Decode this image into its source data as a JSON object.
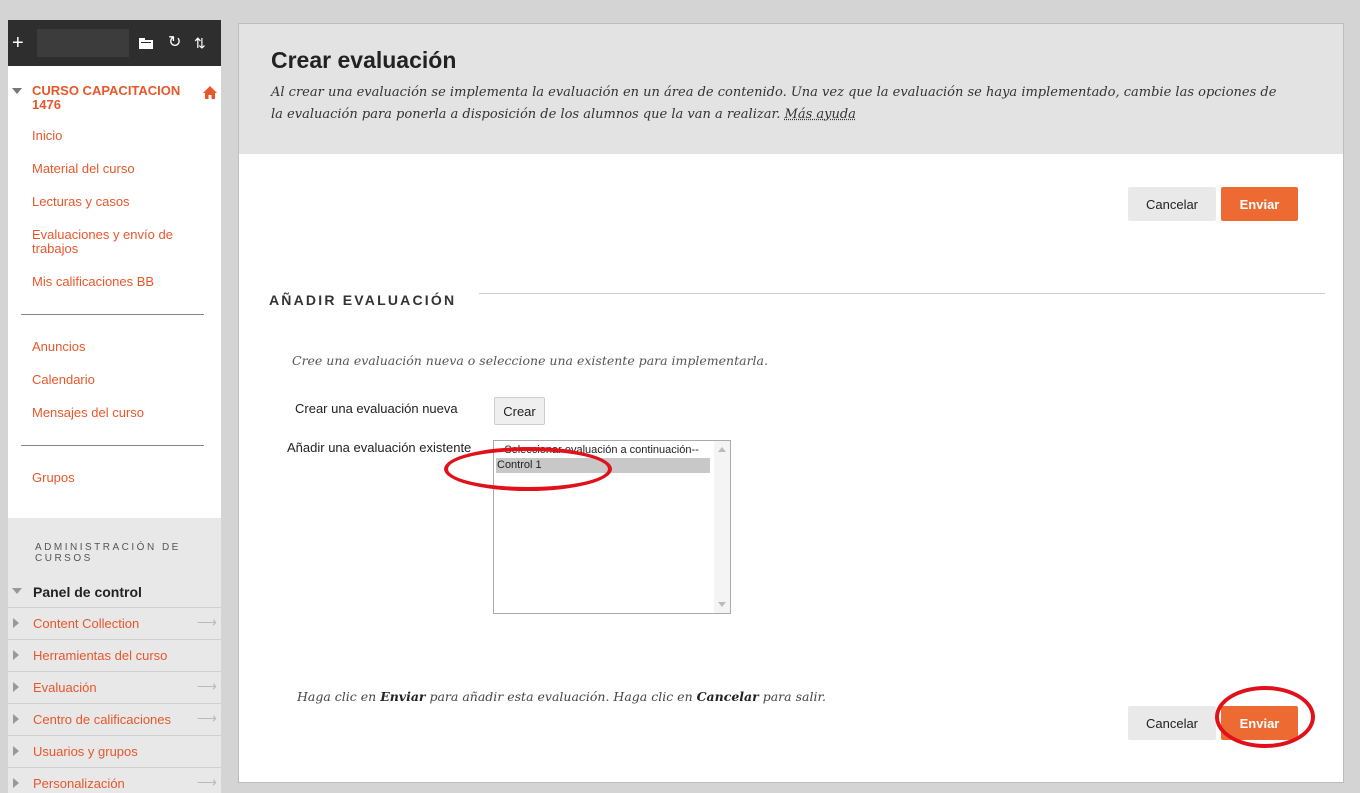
{
  "sidebar": {
    "course_name": "CURSO CAPACITACION 1476",
    "nav_group1": [
      "Inicio",
      "Material del curso",
      "Lecturas y casos",
      "Evaluaciones y envío de trabajos",
      "Mis calificaciones BB"
    ],
    "nav_group2": [
      "Anuncios",
      "Calendario",
      "Mensajes del curso"
    ],
    "nav_group3": [
      "Grupos"
    ],
    "admin_title": "ADMINISTRACIÓN DE CURSOS",
    "panel_title": "Panel de control",
    "panel_items": [
      {
        "label": "Content Collection",
        "has_arrow": true
      },
      {
        "label": "Herramientas del curso",
        "has_arrow": false
      },
      {
        "label": "Evaluación",
        "has_arrow": true
      },
      {
        "label": "Centro de calificaciones",
        "has_arrow": true
      },
      {
        "label": "Usuarios y grupos",
        "has_arrow": false
      },
      {
        "label": "Personalización",
        "has_arrow": true
      }
    ]
  },
  "header": {
    "title": "Crear evaluación",
    "description": "Al crear una evaluación se implementa la evaluación en un área de contenido. Una vez que la evaluación se haya implementado, cambie las opciones de la evaluación para ponerla a disposición de los alumnos que la van a realizar.",
    "help_link": "Más ayuda"
  },
  "buttons": {
    "cancel": "Cancelar",
    "submit": "Enviar"
  },
  "section": {
    "title": "AÑADIR EVALUACIÓN",
    "instruction": "Cree una evaluación nueva o seleccione una existente para implementarla.",
    "new_label": "Crear una evaluación nueva",
    "create_button": "Crear",
    "existing_label": "Añadir una evaluación existente",
    "options": [
      "--Seleccionar evaluación a continuación--",
      "Control 1"
    ],
    "selected_option": "Control 1"
  },
  "footer": {
    "text_1": "Haga clic en ",
    "bold_1": "Enviar",
    "text_2": " para añadir esta evaluación. Haga clic en ",
    "bold_2": "Cancelar",
    "text_3": " para salir."
  },
  "colors": {
    "accent": "#ed6b32",
    "link": "#e8572b",
    "annotation": "#e0111a"
  }
}
